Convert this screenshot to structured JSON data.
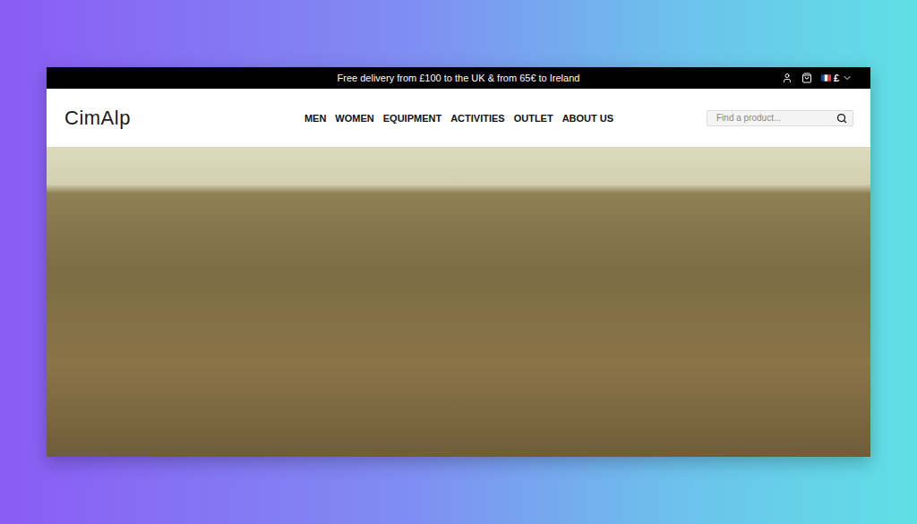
{
  "window": {
    "title": "CimAlp"
  },
  "top_bar": {
    "message": "Free delivery from £100 to the UK & from 65€ to Ireland",
    "currency": "£"
  },
  "header": {
    "logo": "CimAlp"
  },
  "nav": [
    {
      "label": "MEN"
    },
    {
      "label": "WOMEN"
    },
    {
      "label": "EQUIPMENT"
    },
    {
      "label": "ACTIVITIES"
    },
    {
      "label": "OUTLET"
    },
    {
      "label": "ABOUT US"
    }
  ],
  "search": {
    "placeholder": "Find a product..."
  }
}
